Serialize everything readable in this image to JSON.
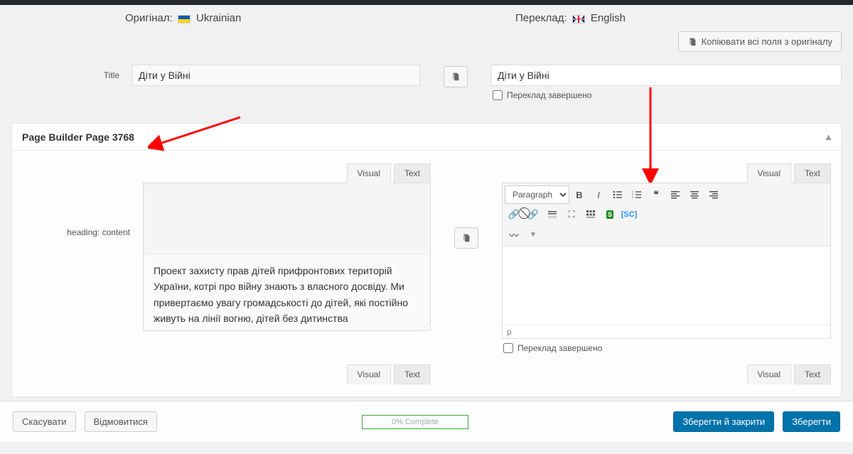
{
  "lang": {
    "original_label": "Оригінал:",
    "original_name": "Ukrainian",
    "translation_label": "Переклад:",
    "translation_name": "English"
  },
  "buttons": {
    "copy_all": "Копіювати всі поля з оригіналу",
    "cancel": "Скасувати",
    "decline": "Відмовитися",
    "save_close": "Зберегти й закрити",
    "save": "Зберегти"
  },
  "fields": {
    "title_label": "Title",
    "title_src": "Діти у Війні",
    "title_dst": "Діти у Війні",
    "translation_complete": "Переклад завершено"
  },
  "panel": {
    "title": "Page Builder Page 3768",
    "heading_label": "heading: content",
    "tabs": {
      "visual": "Visual",
      "text": "Text"
    },
    "src_content": "Проект захисту прав дітей прифронтових територій України, котрі про війну знають з власного досвіду. Ми привертаємо увагу громадськості до дітей, які постійно живуть на лінії вогню, дітей без дитинства",
    "format_sel": "Paragraph",
    "status_p": "p"
  },
  "progress": {
    "label": "0% Complete"
  }
}
